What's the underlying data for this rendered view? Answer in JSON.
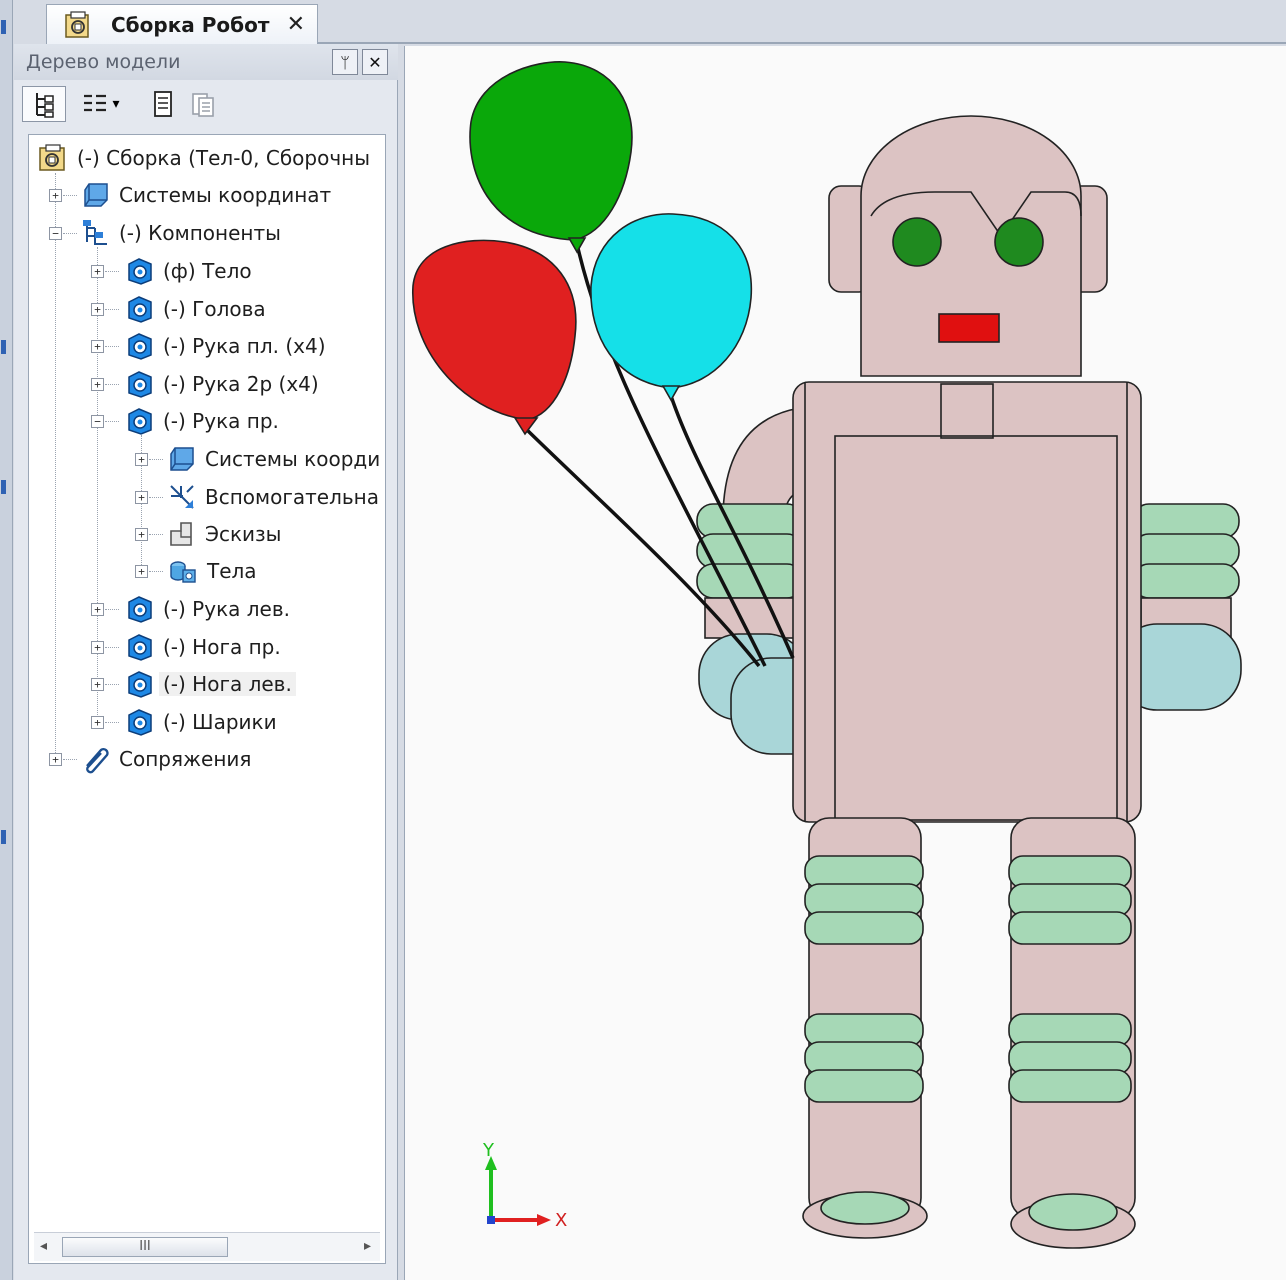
{
  "document_tab": {
    "title": "Сборка Робот",
    "close_glyph": "✕",
    "icon": "assembly-doc-icon"
  },
  "panel": {
    "title": "Дерево модели",
    "pin_glyph": "ᛘ",
    "close_glyph": "✕"
  },
  "toolbar": {
    "buttons": [
      {
        "name": "tree-structure-view-icon"
      },
      {
        "name": "tree-list-view-icon",
        "has_dropdown": true,
        "dropdown_glyph": "▾"
      },
      {
        "name": "document-properties-icon"
      },
      {
        "name": "copy-properties-icon"
      }
    ]
  },
  "tree": {
    "items": [
      {
        "label": "(-) Сборка (Тел-0, Сборочны",
        "icon": "assembly-icon",
        "level": 0,
        "expander": ""
      },
      {
        "label": "Системы координат",
        "icon": "coordinate-systems-icon",
        "level": 1,
        "expander": "+"
      },
      {
        "label": "(-) Компоненты",
        "icon": "components-icon",
        "level": 1,
        "expander": "−"
      },
      {
        "label": "(ф) Тело",
        "icon": "part-icon",
        "level": 2,
        "expander": "+"
      },
      {
        "label": "(-) Голова",
        "icon": "part-icon",
        "level": 2,
        "expander": "+"
      },
      {
        "label": "(-) Рука пл. (x4)",
        "icon": "part-icon",
        "level": 2,
        "expander": "+"
      },
      {
        "label": "(-) Рука 2р (x4)",
        "icon": "part-icon",
        "level": 2,
        "expander": "+"
      },
      {
        "label": "(-) Рука пр.",
        "icon": "part-icon",
        "level": 2,
        "expander": "−"
      },
      {
        "label": "Системы коорди",
        "icon": "coordinate-systems-icon",
        "level": 3,
        "expander": "+"
      },
      {
        "label": "Вспомогательна",
        "icon": "auxiliary-geometry-icon",
        "level": 3,
        "expander": "+"
      },
      {
        "label": "Эскизы",
        "icon": "sketches-icon",
        "level": 3,
        "expander": "+"
      },
      {
        "label": "Тела",
        "icon": "bodies-icon",
        "level": 3,
        "expander": "+"
      },
      {
        "label": "(-) Рука лев.",
        "icon": "part-icon",
        "level": 2,
        "expander": "+"
      },
      {
        "label": "(-) Нога пр.",
        "icon": "part-icon",
        "level": 2,
        "expander": "+"
      },
      {
        "label": "(-) Нога лев.",
        "icon": "part-icon",
        "level": 2,
        "expander": "+",
        "selected": true
      },
      {
        "label": "(-) Шарики",
        "icon": "part-icon",
        "level": 2,
        "expander": "+"
      },
      {
        "label": "Сопряжения",
        "icon": "mates-icon",
        "level": 1,
        "expander": "+"
      }
    ]
  },
  "scrollbar": {
    "left_glyph": "◂",
    "right_glyph": "▸",
    "grip_glyph": "III"
  },
  "viewport": {
    "axis_x_label": "X",
    "axis_y_label": "Y",
    "colors": {
      "robot_body": "#dcc3c3",
      "robot_rings": "#a6d8b6",
      "robot_hands": "#a9d6d8",
      "robot_eyes": "#1f8a1f",
      "robot_mouth": "#e01010",
      "balloon_green": "#0aa80a",
      "balloon_cyan": "#15e0e8",
      "balloon_red": "#e02020",
      "axis_y": "#1fbf1f",
      "axis_x": "#e02020"
    }
  }
}
